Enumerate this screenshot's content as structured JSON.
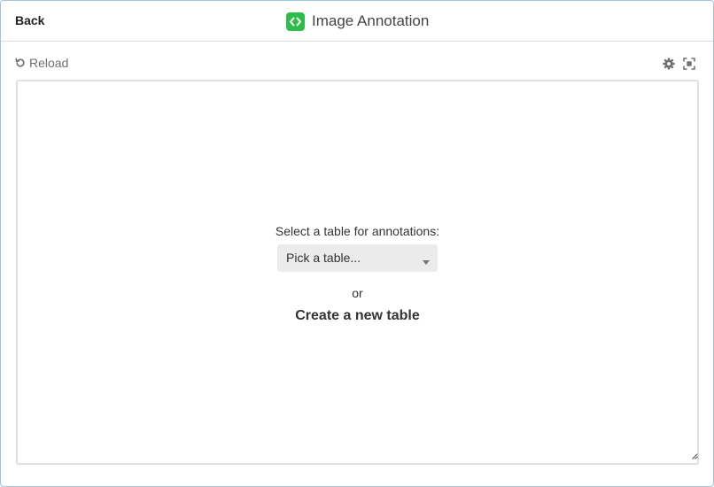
{
  "header": {
    "back_label": "Back",
    "app_title": "Image Annotation"
  },
  "toolbar": {
    "reload_label": "Reload"
  },
  "widget": {
    "select_label": "Select a table for annotations:",
    "select_placeholder": "Pick a table...",
    "or_label": "or",
    "create_label": "Create a new table"
  },
  "icons": {
    "app": "code-brackets-icon",
    "reload": "reload-icon",
    "settings": "gear-icon",
    "fullscreen": "fullscreen-icon",
    "caret": "caret-down-icon",
    "resize": "resize-handle-icon"
  },
  "colors": {
    "accent": "#2ebd48",
    "window_border": "#9cc3e6",
    "select_bg": "#ebebeb"
  }
}
